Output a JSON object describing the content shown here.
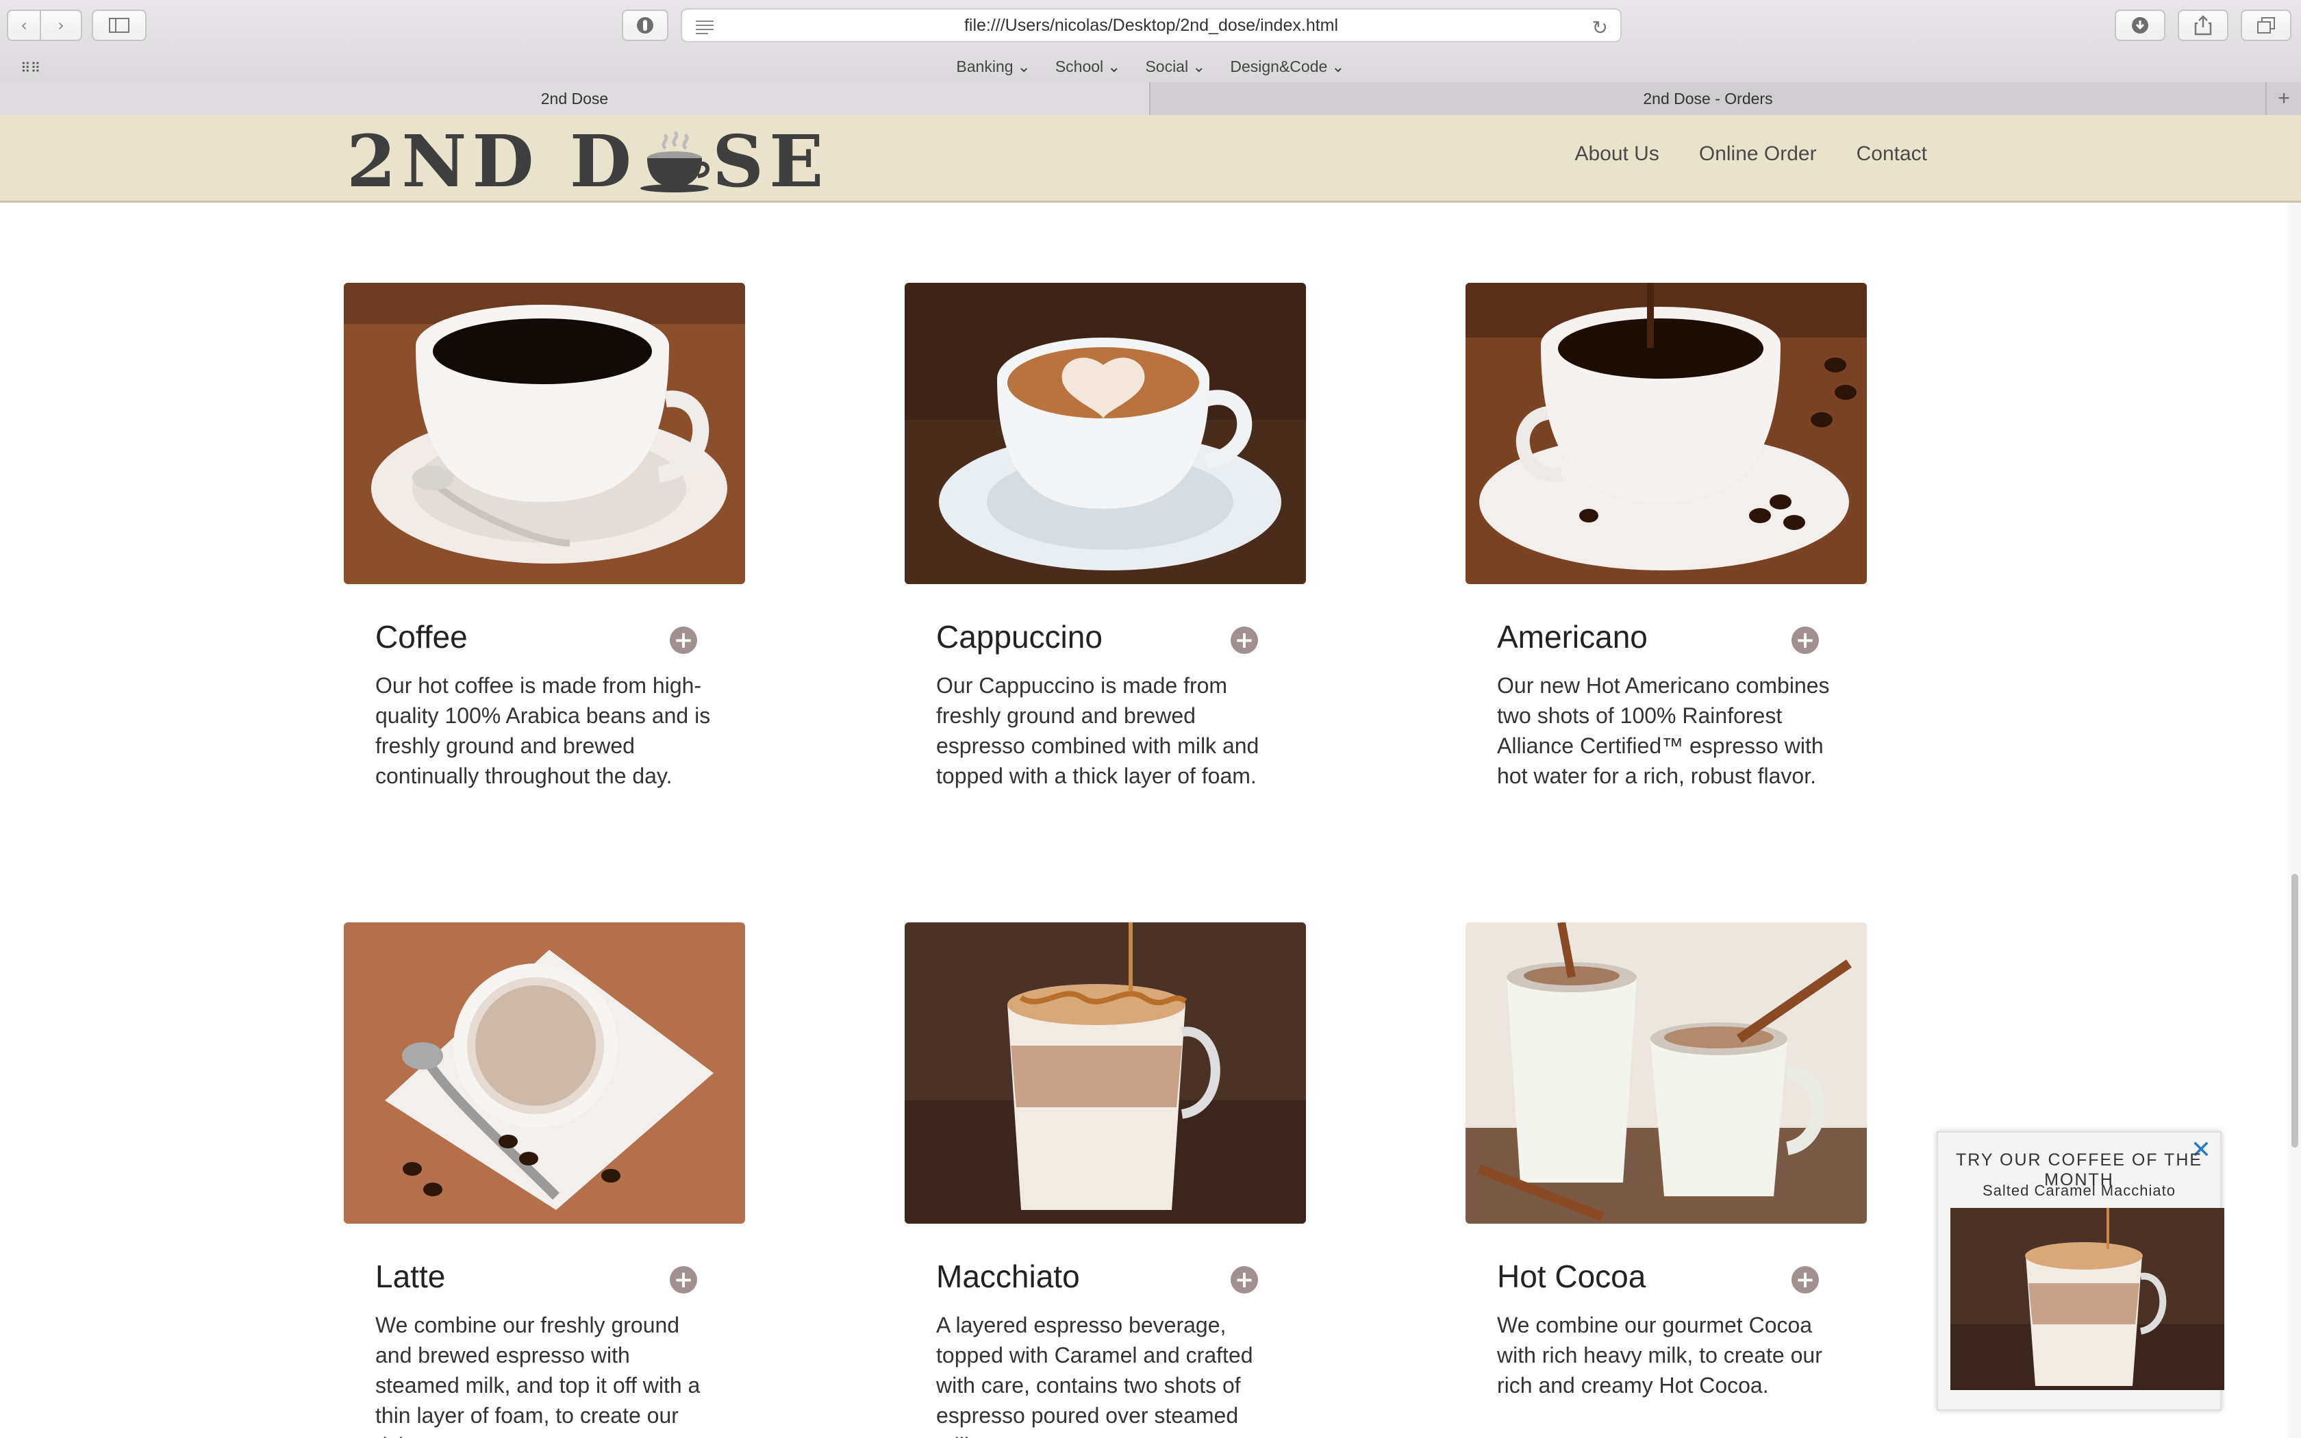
{
  "browser": {
    "url": "file:///Users/nicolas/Desktop/2nd_dose/index.html",
    "favorites": [
      "Banking",
      "School",
      "Social",
      "Design&Code"
    ],
    "tabs": [
      {
        "label": "2nd Dose",
        "active": true
      },
      {
        "label": "2nd Dose - Orders",
        "active": false
      }
    ],
    "new_tab": "+"
  },
  "site": {
    "logo": {
      "before": "2ND D",
      "after": "SE"
    },
    "nav": [
      "About Us",
      "Online Order",
      "Contact"
    ]
  },
  "products": [
    {
      "title": "Coffee",
      "desc": "Our hot coffee is made from high-quality 100% Arabica beans and is freshly ground and brewed continually throughout the day."
    },
    {
      "title": "Cappuccino",
      "desc": "Our Cappuccino is made from freshly ground and brewed espresso combined with milk and topped with a thick layer of foam."
    },
    {
      "title": "Americano",
      "desc": "Our new Hot Americano combines two shots of 100% Rainforest Alliance Certified™ espresso with hot water for a rich, robust flavor."
    },
    {
      "title": "Latte",
      "desc": "We combine our freshly ground and brewed espresso with steamed milk, and top it off with a thin layer of foam, to create our rich"
    },
    {
      "title": "Macchiato",
      "desc": "A layered espresso beverage, topped with Caramel and crafted with care, contains two shots of espresso poured over steamed milk"
    },
    {
      "title": "Hot Cocoa",
      "desc": "We combine our gourmet Cocoa with rich heavy milk, to create our rich and creamy Hot Cocoa."
    }
  ],
  "plus_symbol": "+",
  "popup": {
    "title": "TRY OUR COFFEE OF THE MONTH",
    "subtitle": "Salted Caramel Macchiato",
    "close": "✕"
  },
  "colors": {
    "header_bg": "#e9e2cc",
    "accent_plus": "#a09090",
    "close_blue": "#2a79c9"
  }
}
